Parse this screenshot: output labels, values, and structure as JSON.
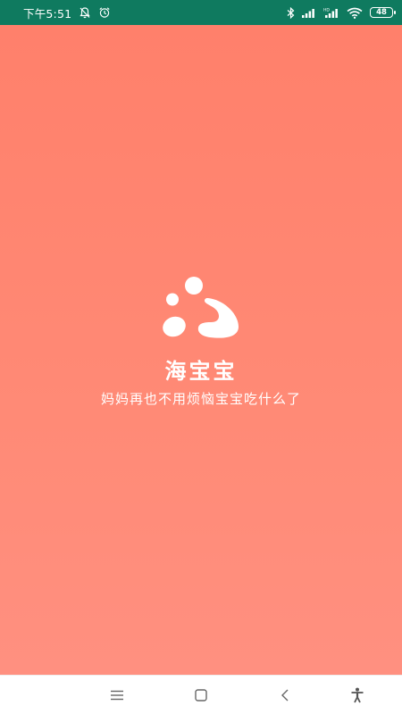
{
  "status_bar": {
    "time": "下午5:51",
    "battery_level": "48",
    "icons": [
      "notification-muted-icon",
      "alarm-icon",
      "bluetooth-icon",
      "cellular-signal-icon",
      "cellular-signal-hd-icon",
      "wifi-icon",
      "battery-icon"
    ],
    "background_color": "#0f7a5f"
  },
  "splash": {
    "app_name": "海宝宝",
    "tagline": "妈妈再也不用烦恼宝宝吃什么了",
    "logo_icon": "app-logo-icon",
    "background_color": "#ff806b"
  },
  "navigation_bar": {
    "buttons": [
      "menu-icon",
      "home-icon",
      "back-icon",
      "accessibility-icon"
    ]
  }
}
